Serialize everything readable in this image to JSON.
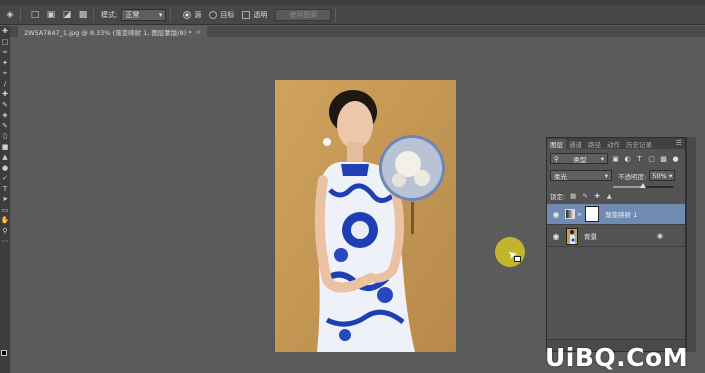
{
  "options_bar": {
    "mode_label": "模式:",
    "mode_value": "正常",
    "radio_label": "源",
    "pattern_label": "目标",
    "transparent_label": "透明",
    "use_pattern_button": "使用图案"
  },
  "document_tab": {
    "title": "2W5A7847_1.jpg @ 8.33% (渐变映射 1, 图层蒙版/8) *",
    "close_glyph": "×"
  },
  "layers_panel": {
    "tabs": [
      "图层",
      "通道",
      "路径",
      "动作",
      "历史记录"
    ],
    "active_tab": "图层",
    "filter_kind": "类型",
    "blend_mode": "柔光",
    "opacity_label": "不透明度:",
    "opacity_value": "50%",
    "opacity": 0.5,
    "lock_label": "锁定:",
    "layers": [
      {
        "name": "渐变映射 1",
        "selected": true,
        "visible": true
      },
      {
        "name": "背景",
        "selected": false,
        "visible": true,
        "locked": true
      }
    ]
  },
  "watermark": {
    "text": "UiBQ.CoM"
  },
  "colors": {
    "canvas_bg": "#5b5b5b",
    "photo_bg": "#c79a58",
    "selection": "#6f8bb1",
    "cursor_ring": "#cebe28",
    "foreground": "#000000",
    "background": "#ffffff"
  }
}
